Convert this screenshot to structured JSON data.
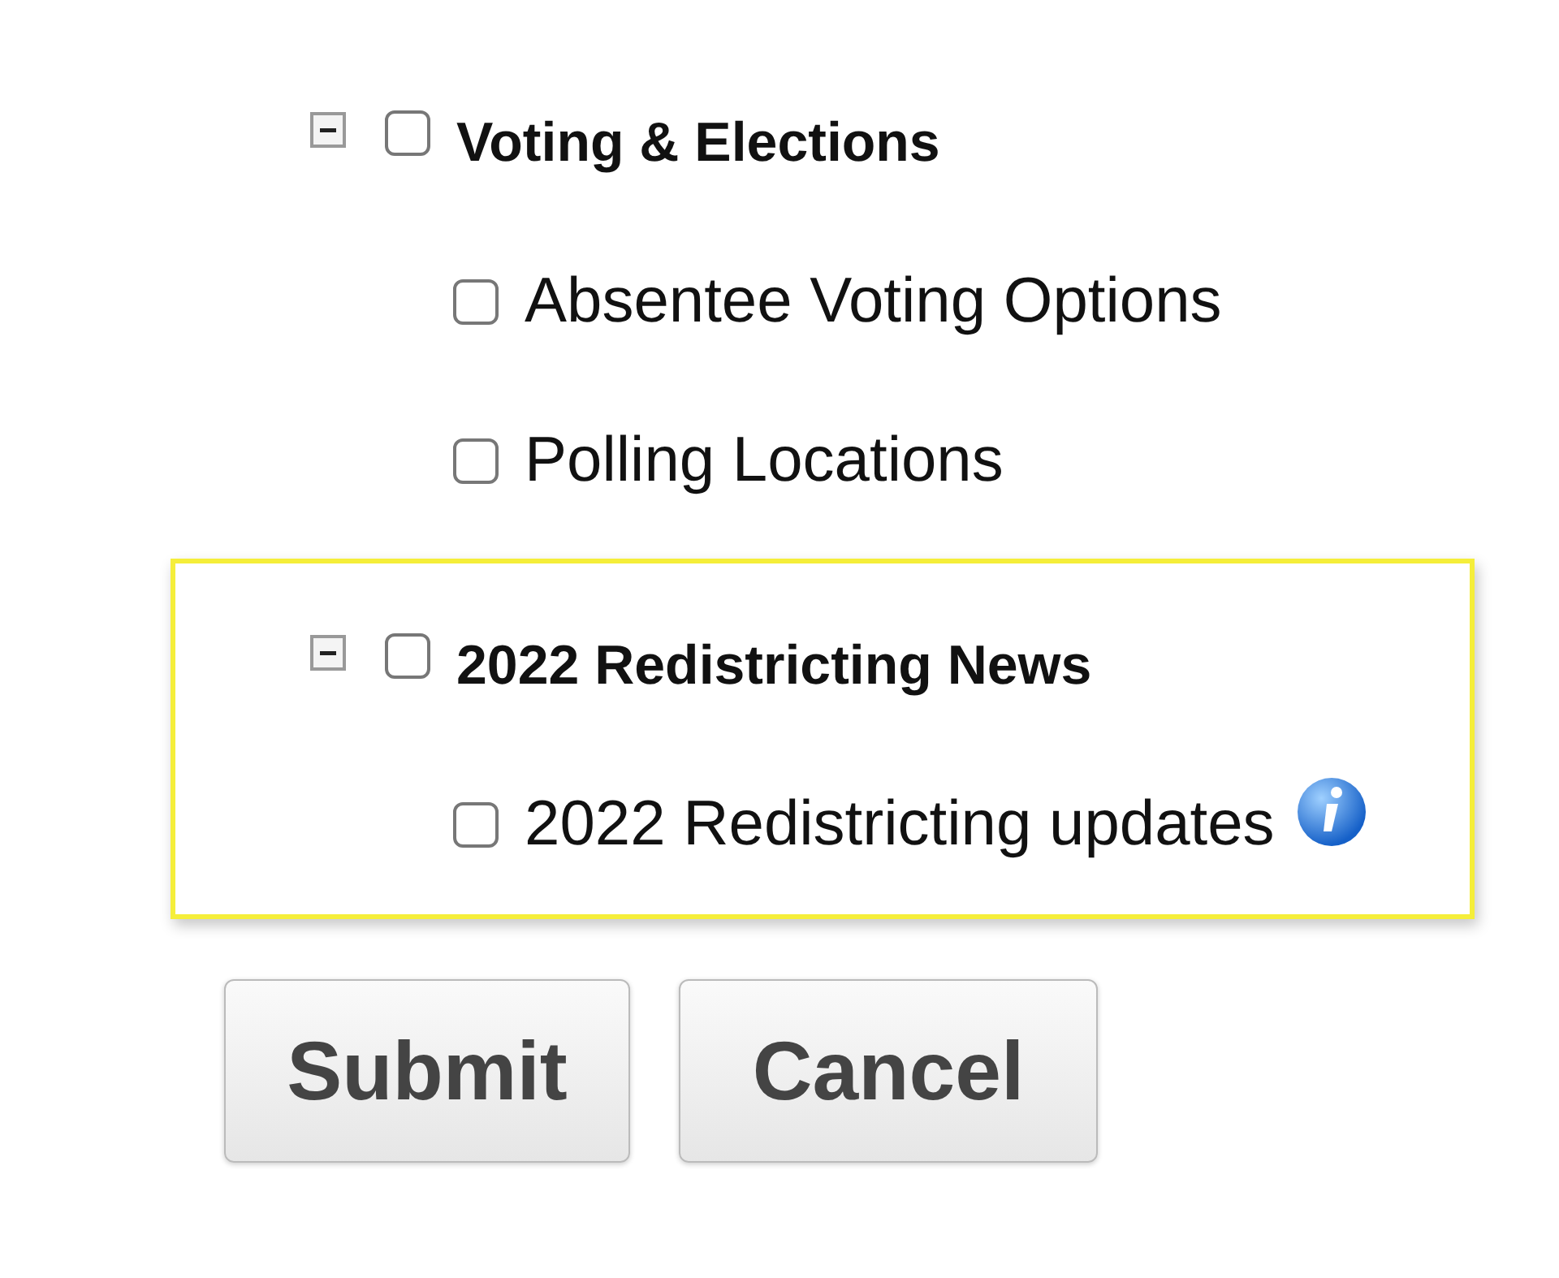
{
  "groups": [
    {
      "label": "Voting & Elections",
      "expanded": true,
      "checked": false,
      "highlighted": false,
      "children": [
        {
          "label": "Absentee Voting Options",
          "checked": false,
          "info": false
        },
        {
          "label": "Polling Locations",
          "checked": false,
          "info": false
        }
      ]
    },
    {
      "label": "2022 Redistricting News",
      "expanded": true,
      "checked": false,
      "highlighted": true,
      "children": [
        {
          "label": "2022 Redistricting updates",
          "checked": false,
          "info": true
        }
      ]
    }
  ],
  "buttons": [
    "Submit",
    "Cancel"
  ]
}
